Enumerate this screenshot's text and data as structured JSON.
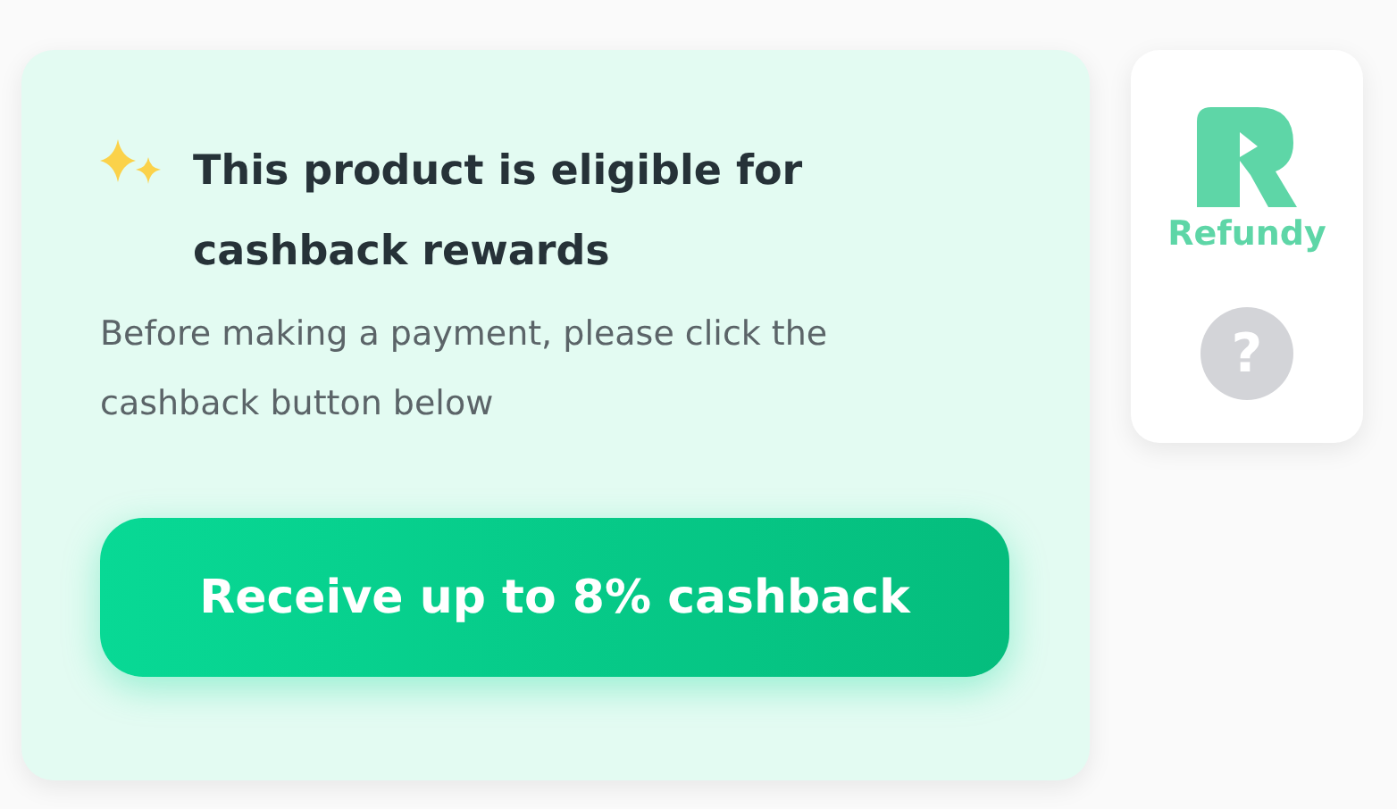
{
  "offer": {
    "title": "This product is eligible for cashback rewards",
    "description": "Before making a payment, please click the cashback button below",
    "button": "Receive up to 8% cashback"
  },
  "sidebar": {
    "brand": "Refundy",
    "help": "?"
  }
}
